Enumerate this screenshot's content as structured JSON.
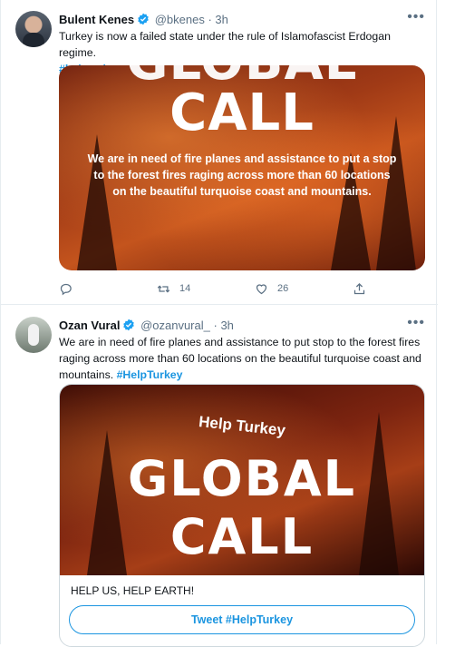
{
  "tweets": [
    {
      "name": "Bulent Kenes",
      "handle": "@bkenes",
      "time": "3h",
      "text": "Turkey is now a failed state under the rule of Islamofascist Erdogan regime.",
      "hashtag": "#helpturkey",
      "media": {
        "line1": "GLOBAL",
        "line2": "CALL",
        "caption": "We are in need of fire planes and assistance to put a stop to the forest fires raging across more than 60 locations on the beautiful turquoise coast and mountains."
      },
      "retweets": "14",
      "likes": "26"
    },
    {
      "name": "Ozan Vural",
      "handle": "@ozanvural_",
      "time": "3h",
      "text": "We are in need of fire planes and assistance to put stop to the forest fires raging across more than 60 locations on the beautiful turquoise coast and mountains.",
      "hashtag": "#HelpTurkey",
      "media": {
        "sub": "Help Turkey",
        "line1": "GLOBAL",
        "line2": "CALL"
      },
      "card": {
        "text": "HELP US, HELP EARTH!",
        "button": "Tweet #HelpTurkey"
      }
    }
  ],
  "separator": "·",
  "colors": {
    "link": "#1b95e0",
    "verified": "#1da1f2",
    "muted": "#5b7083"
  }
}
